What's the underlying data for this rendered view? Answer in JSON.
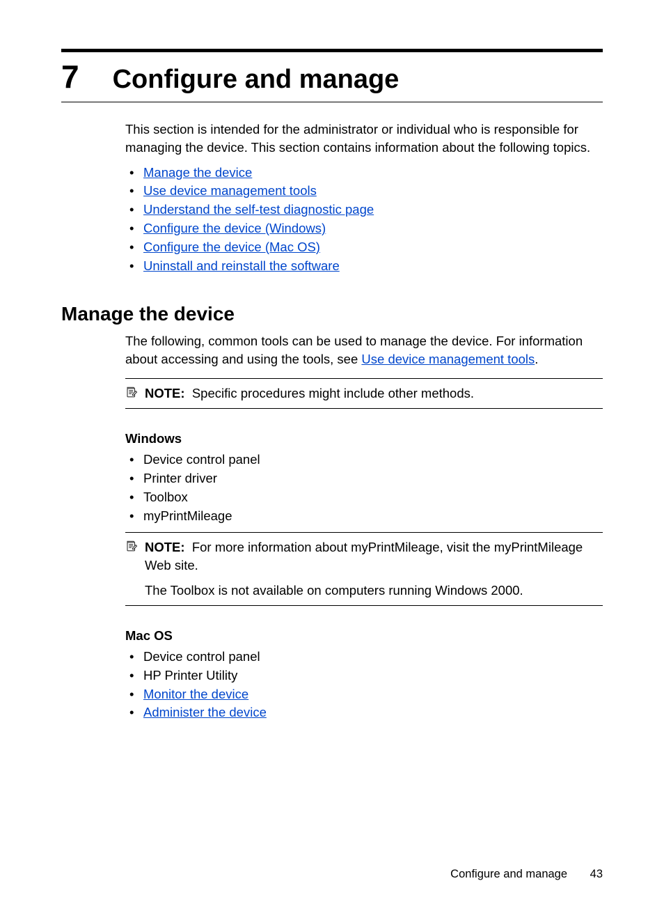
{
  "chapter": {
    "number": "7",
    "title": "Configure and manage"
  },
  "intro": "This section is intended for the administrator or individual who is responsible for managing the device. This section contains information about the following topics.",
  "toc": [
    "Manage the device",
    "Use device management tools",
    "Understand the self-test diagnostic page",
    "Configure the device (Windows)",
    "Configure the device (Mac OS)",
    "Uninstall and reinstall the software"
  ],
  "section1": {
    "heading": "Manage the device",
    "body_prefix": "The following, common tools can be used to manage the device. For information about accessing and using the tools, see ",
    "body_link": "Use device management tools",
    "body_suffix": "."
  },
  "note1": {
    "label": "NOTE:",
    "text": "Specific procedures might include other methods."
  },
  "windows": {
    "heading": "Windows",
    "items": [
      "Device control panel",
      "Printer driver",
      "Toolbox",
      "myPrintMileage"
    ]
  },
  "note2": {
    "label": "NOTE:",
    "text": "For more information about myPrintMileage, visit the myPrintMileage Web site.",
    "extra": "The Toolbox is not available on computers running Windows 2000."
  },
  "macos": {
    "heading": "Mac OS",
    "items_plain": [
      "Device control panel",
      "HP Printer Utility"
    ],
    "items_link": [
      "Monitor the device",
      "Administer the device"
    ]
  },
  "footer": {
    "title": "Configure and manage",
    "page": "43"
  }
}
